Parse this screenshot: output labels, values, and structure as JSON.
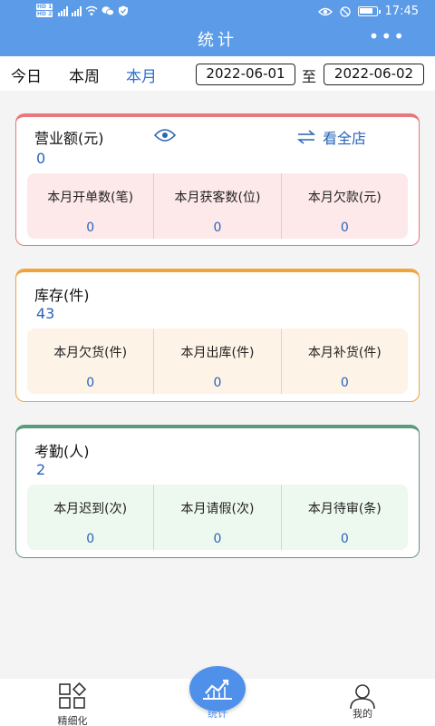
{
  "status": {
    "time": "17:45",
    "net_speed_top": "HD 1",
    "net_speed_bottom": "HD 2",
    "sig_a": "4G",
    "sig_b": "4G"
  },
  "header": {
    "title": "统计",
    "more_icon": "more-dots-icon"
  },
  "filters": {
    "tabs": [
      {
        "label": "今日"
      },
      {
        "label": "本周"
      },
      {
        "label": "本月",
        "active": true
      }
    ],
    "start_date": "2022-06-01",
    "to_label": "至",
    "end_date": "2022-06-02"
  },
  "revenue": {
    "title": "营业额(元)",
    "value": "0",
    "view_all_label": "看全店",
    "accent": "#e9787a",
    "panel_bg": "#fde9ea",
    "stats": [
      {
        "label": "本月开单数(笔)",
        "value": "0"
      },
      {
        "label": "本月获客数(位)",
        "value": "0"
      },
      {
        "label": "本月欠款(元)",
        "value": "0"
      }
    ]
  },
  "inventory": {
    "title": "库存(件)",
    "value": "43",
    "accent": "#f0a43a",
    "panel_bg": "#fdf3e7",
    "stats": [
      {
        "label": "本月欠货(件)",
        "value": "0"
      },
      {
        "label": "本月出库(件)",
        "value": "0"
      },
      {
        "label": "本月补货(件)",
        "value": "0"
      }
    ]
  },
  "attendance": {
    "title": "考勤(人)",
    "value": "2",
    "accent": "#5a9a7e",
    "panel_bg": "#edf8ee",
    "stats": [
      {
        "label": "本月迟到(次)",
        "value": "0"
      },
      {
        "label": "本月请假(次)",
        "value": "0"
      },
      {
        "label": "本月待审(条)",
        "value": "0"
      }
    ]
  },
  "nav": {
    "left_label": "精细化",
    "center_label": "统计",
    "right_label": "我的",
    "active_color": "#4f91ea"
  }
}
